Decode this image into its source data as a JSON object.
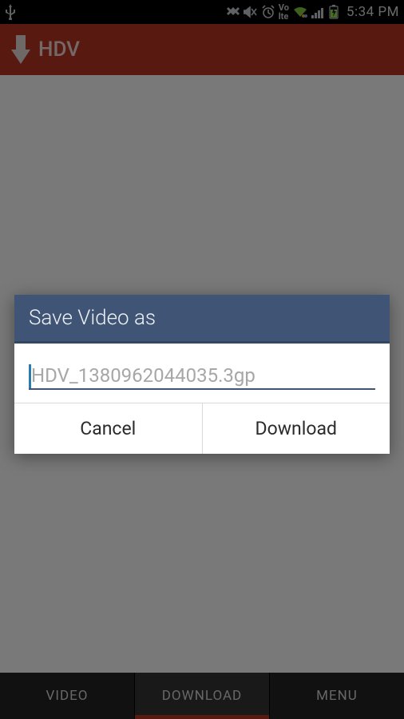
{
  "status": {
    "clock": "5:34 PM"
  },
  "appbar": {
    "title": "HDV"
  },
  "tabs": {
    "items": [
      {
        "label": "VIDEO"
      },
      {
        "label": "DOWNLOAD"
      },
      {
        "label": "MENU"
      }
    ],
    "active_index": 1
  },
  "dialog": {
    "title": "Save Video as",
    "filename": "HDV_1380962044035.3gp",
    "cancel_label": "Cancel",
    "download_label": "Download"
  },
  "colors": {
    "brand_red": "#b13323",
    "dialog_header": "#405576"
  }
}
